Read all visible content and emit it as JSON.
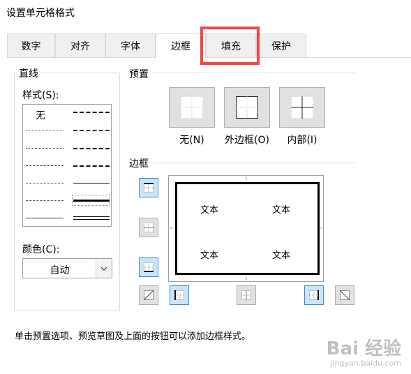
{
  "window": {
    "title": "设置单元格格式"
  },
  "tabs": [
    {
      "label": "数字"
    },
    {
      "label": "对齐"
    },
    {
      "label": "字体"
    },
    {
      "label": "边框"
    },
    {
      "label": "填充"
    },
    {
      "label": "保护"
    }
  ],
  "active_tab": "边框",
  "highlight_color": "#f04848",
  "line_group": {
    "title": "直线",
    "style_label": "样式(S):",
    "none_label": "无",
    "color_label": "颜色(C):",
    "color_value": "自动"
  },
  "presets": {
    "title": "预置",
    "items": [
      {
        "label": "无(N)"
      },
      {
        "label": "外边框(O)"
      },
      {
        "label": "内部(I)"
      }
    ]
  },
  "border": {
    "title": "边框",
    "preview_text": [
      "文本",
      "文本",
      "文本",
      "文本"
    ]
  },
  "hint_text": "单击预置选项、预览草图及上面的按钮可以添加边框样式。",
  "watermark": {
    "brand": "Bai 经验",
    "url": "jingyan.baidu.com"
  },
  "colors": {
    "toggle_on_bg": "#cce4f7",
    "toggle_on_border": "#3c8ccc",
    "button_bg": "#e1e1e1"
  }
}
